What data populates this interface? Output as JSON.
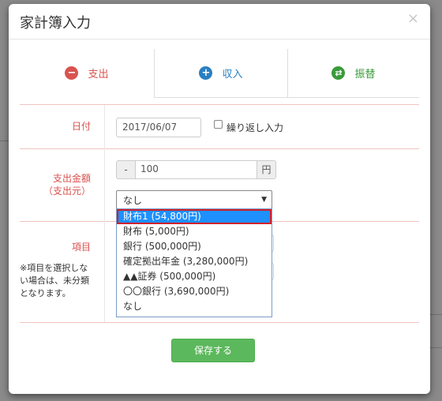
{
  "modal": {
    "title": "家計簿入力",
    "close": "×"
  },
  "tabs": [
    {
      "label": "支出",
      "icon": "minus-circle-icon",
      "color": "#d9534f",
      "glyph": "−"
    },
    {
      "label": "収入",
      "icon": "plus-circle-icon",
      "color": "#2a7fc1",
      "glyph": "+"
    },
    {
      "label": "振替",
      "icon": "transfer-icon",
      "color": "#3a9a3a",
      "glyph": "⇄"
    }
  ],
  "form": {
    "date_label": "日付",
    "date_value": "2017/06/07",
    "repeat_label": "繰り返し入力",
    "amount_label_line1": "支出金額",
    "amount_label_line2": "（支出元）",
    "minus_addon": "-",
    "amount_value": "100",
    "yen_addon": "円",
    "source_select_value": "なし",
    "item_label": "項目",
    "item_note": "※項目を選択しない場合は、未分類となります。",
    "save_button": "保存する"
  },
  "dropdown_options": [
    "財布1 (54,800円)",
    "財布 (5,000円)",
    "銀行 (500,000円)",
    "確定拠出年金 (3,280,000円)",
    "▲▲証券 (500,000円)",
    "〇〇銀行 (3,690,000円)",
    "なし"
  ],
  "dropdown_selected_index": 0,
  "colors": {
    "accent_label": "#d9534f",
    "save_button": "#5cb85c",
    "highlight": "#1e90ff",
    "highlight_border": "#d0202a"
  }
}
